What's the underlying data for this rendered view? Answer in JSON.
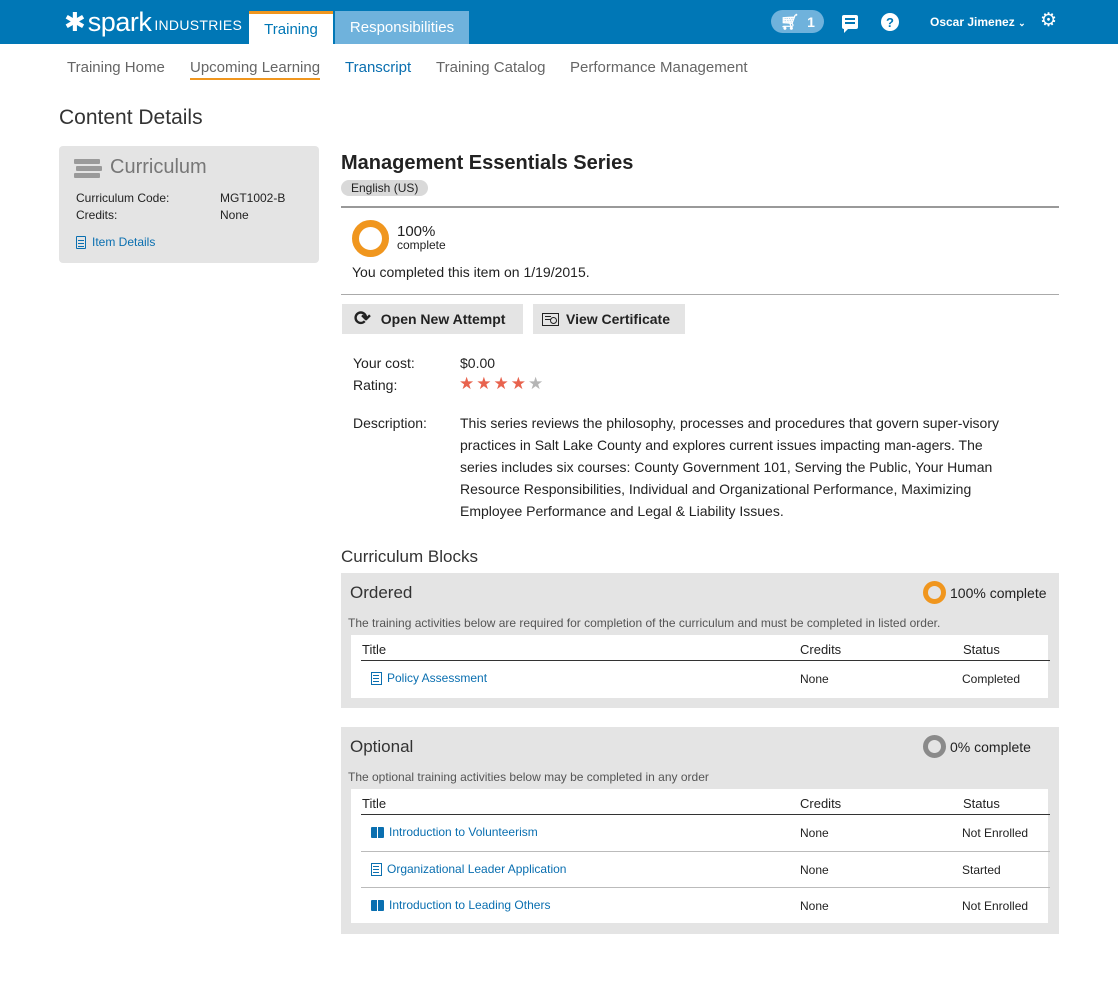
{
  "header": {
    "logo_mark": "✱",
    "logo_word": "spark",
    "logo_sub": "INDUSTRIES",
    "tabs": [
      {
        "label": "Training",
        "active": true
      },
      {
        "label": "Responsibilities",
        "active": false
      }
    ],
    "cart_count": "1",
    "user_name": "Oscar Jimenez",
    "help_glyph": "?",
    "colors": {
      "bar": "#0077b6",
      "accent": "#f0961e"
    }
  },
  "subnav": {
    "items": [
      {
        "label": "Training Home"
      },
      {
        "label": "Upcoming Learning"
      },
      {
        "label": "Transcript"
      },
      {
        "label": "Training Catalog"
      },
      {
        "label": "Performance Management"
      }
    ]
  },
  "page_title": "Content Details",
  "side_card": {
    "title": "Curriculum",
    "code_label": "Curriculum Code:",
    "code_value": "MGT1002-B",
    "credits_label": "Credits:",
    "credits_value": "None",
    "item_details": "Item Details"
  },
  "main": {
    "title": "Management Essentials Series",
    "language": "English (US)",
    "progress_pct": "100%",
    "progress_sub": "complete",
    "progress_fraction": 1.0,
    "completed_text": "You completed this item on 1/19/2015.",
    "buttons": {
      "attempt": "Open New Attempt",
      "certificate": "View Certificate"
    },
    "cost_label": "Your cost:",
    "cost_value": "$0.00",
    "rating_label": "Rating:",
    "rating": 4,
    "rating_max": 5,
    "description_label": "Description:",
    "description": "This series reviews the philosophy, processes and procedures that govern super-visory practices in Salt Lake County and explores current issues impacting man-agers. The series includes six courses: County Government 101, Serving the Public, Your Human Resource Responsibilities, Individual and Organizational Performance, Maximizing Employee Performance and Legal & Liability Issues."
  },
  "blocks": {
    "title": "Curriculum Blocks",
    "columns": {
      "title": "Title",
      "credits": "Credits",
      "status": "Status"
    },
    "ordered": {
      "name": "Ordered",
      "pct": "100% complete",
      "fraction": 1.0,
      "desc": "The training activities below are required for completion of the curriculum and must be completed in listed order.",
      "rows": [
        {
          "title": "Policy Assessment",
          "credits": "None",
          "status": "Completed",
          "icon": "document-icon"
        }
      ]
    },
    "optional": {
      "name": "Optional",
      "pct": "0% complete",
      "fraction": 0.0,
      "desc": "The optional training activities below may be completed in any order",
      "rows": [
        {
          "title": "Introduction to Volunteerism",
          "credits": "None",
          "status": "Not Enrolled",
          "icon": "book-icon"
        },
        {
          "title": "Organizational Leader Application",
          "credits": "None",
          "status": "Started",
          "icon": "document-icon"
        },
        {
          "title": "Introduction to Leading Others",
          "credits": "None",
          "status": "Not Enrolled",
          "icon": "book-icon"
        }
      ]
    }
  }
}
